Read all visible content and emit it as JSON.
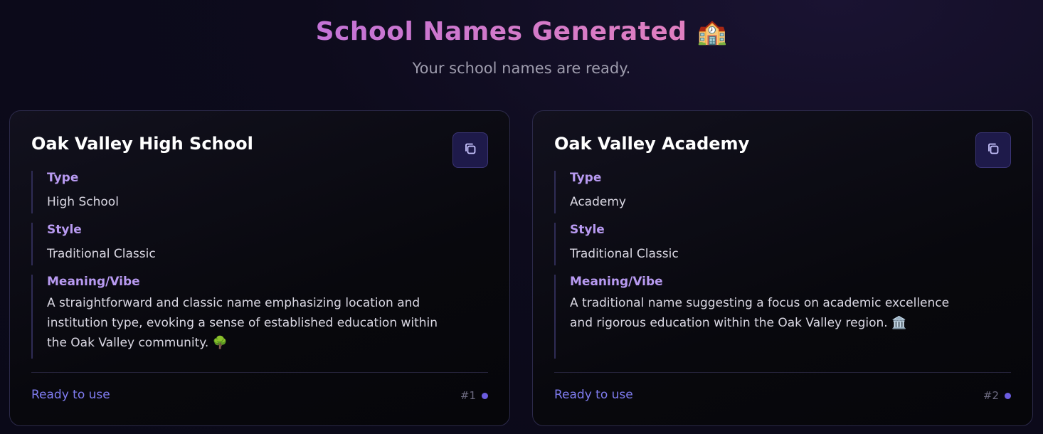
{
  "header": {
    "title": "School Names Generated",
    "title_emoji": "🏫",
    "subtitle": "Your school names are ready."
  },
  "cards": [
    {
      "name": "Oak Valley High School",
      "type_label": "Type",
      "type_value": "High School",
      "style_label": "Style",
      "style_value": "Traditional Classic",
      "meaning_label": "Meaning/Vibe",
      "meaning_value": "A straightforward and classic name emphasizing location and institution type, evoking a sense of established education within the Oak Valley community. 🌳",
      "status": "Ready to use",
      "rank": "#1",
      "copy_icon": "copy-icon"
    },
    {
      "name": "Oak Valley Academy",
      "type_label": "Type",
      "type_value": "Academy",
      "style_label": "Style",
      "style_value": "Traditional Classic",
      "meaning_label": "Meaning/Vibe",
      "meaning_value": "A traditional name suggesting a focus on academic excellence and rigorous education within the Oak Valley region. 🏛️",
      "status": "Ready to use",
      "rank": "#2",
      "copy_icon": "copy-icon"
    }
  ],
  "colors": {
    "accent": "#7f7cf0",
    "label": "#b89af1",
    "title_gradient_start": "#c373d6",
    "title_gradient_end": "#e07fc0"
  }
}
